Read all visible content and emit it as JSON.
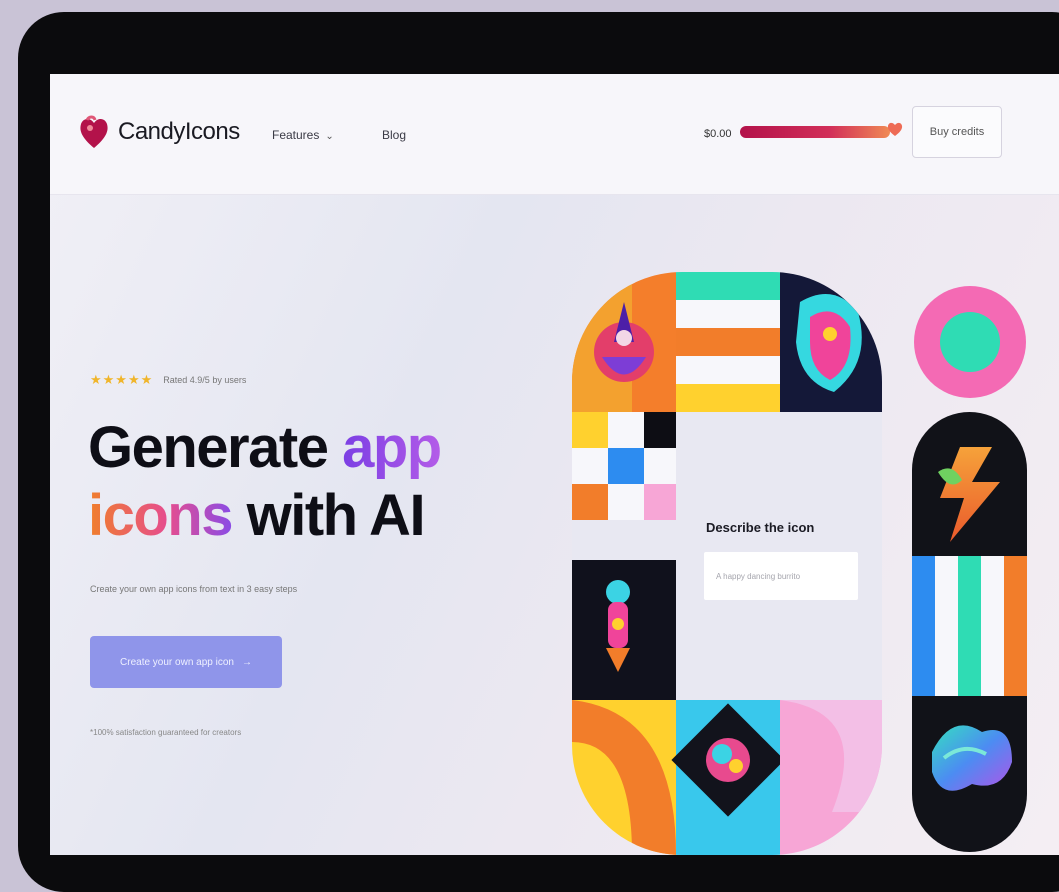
{
  "nav": {
    "brand": "CandyIcons",
    "features_label": "Features",
    "blog_label": "Blog",
    "price_label": "$0.00",
    "buy_label": "Buy credits"
  },
  "hero": {
    "stars": "★★★★★",
    "rating_text": "Rated 4.9/5 by users",
    "headline_word1": "Generate",
    "headline_word2": "app",
    "headline_word3": "icons",
    "headline_word4": "with AI",
    "subtext": "Create your own app icons from text in 3 easy steps",
    "cta_label": "Create your own app icon",
    "cta_arrow": "→",
    "note": "*100% satisfaction guaranteed for creators"
  },
  "describe": {
    "title": "Describe the icon",
    "placeholder": "A happy dancing burrito"
  },
  "colors": {
    "accent_purple": "#8f95ea",
    "brand_red": "#b3124a",
    "teal": "#2fdcb4",
    "orange": "#f27d2a",
    "pink": "#f46ab4",
    "navy": "#141838",
    "yellow": "#ffd12e"
  },
  "icons": {
    "logo": "candy-heart-logo",
    "dropdown": "chevron-down-icon",
    "heart": "heart-icon"
  }
}
